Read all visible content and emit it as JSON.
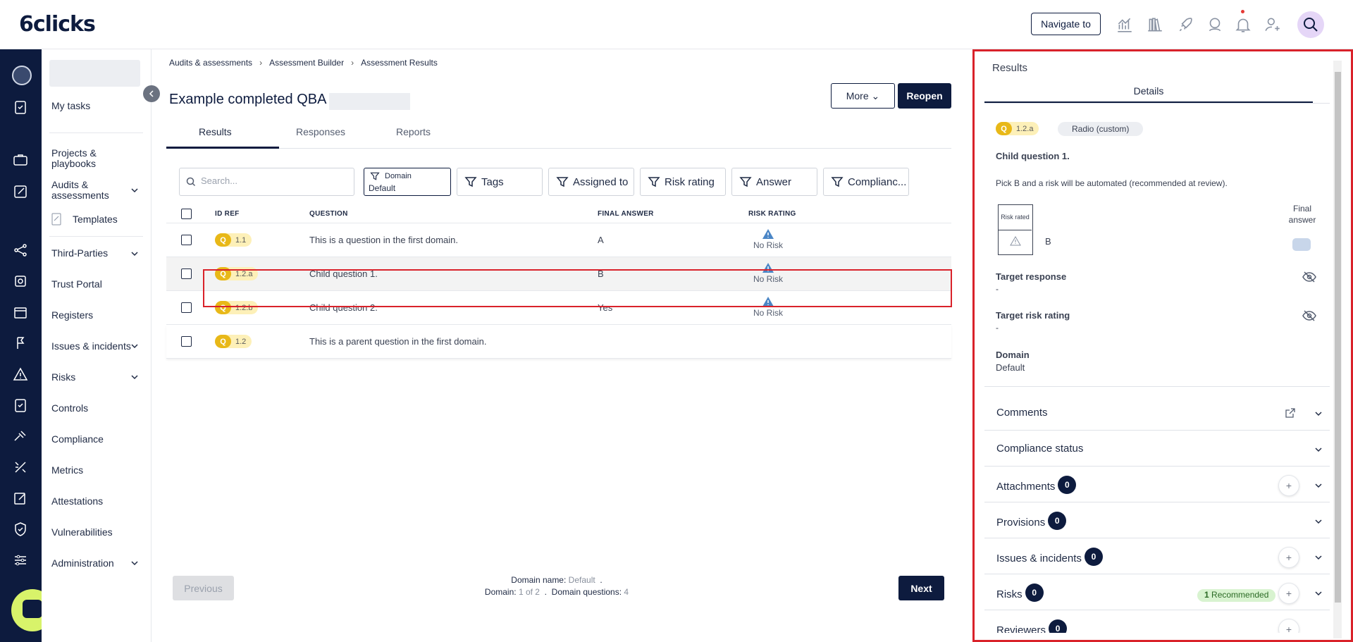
{
  "app": {
    "logo": "6clicks"
  },
  "topbar": {
    "navigate_label": "Navigate to"
  },
  "sidebar": {
    "items": [
      {
        "label": "My tasks"
      },
      {
        "label": "Projects & playbooks"
      },
      {
        "label": "Audits & assessments"
      },
      {
        "label": "Templates"
      },
      {
        "label": "Third-Parties"
      },
      {
        "label": "Trust Portal"
      },
      {
        "label": "Registers"
      },
      {
        "label": "Issues & incidents"
      },
      {
        "label": "Risks"
      },
      {
        "label": "Controls"
      },
      {
        "label": "Compliance"
      },
      {
        "label": "Metrics"
      },
      {
        "label": "Attestations"
      },
      {
        "label": "Vulnerabilities"
      },
      {
        "label": "Administration"
      }
    ]
  },
  "breadcrumb": [
    "Audits & assessments",
    "Assessment Builder",
    "Assessment Results"
  ],
  "page": {
    "title": "Example completed QBA",
    "more_label": "More",
    "reopen_label": "Reopen"
  },
  "tabs": [
    "Results",
    "Responses",
    "Reports"
  ],
  "filters": {
    "search_placeholder": "Search...",
    "domain_label": "Domain",
    "domain_value": "Default",
    "tags": "Tags",
    "assigned": "Assigned to",
    "risk": "Risk rating",
    "answer": "Answer",
    "compliance": "Complianc..."
  },
  "table": {
    "headers": {
      "id": "ID REF",
      "question": "QUESTION",
      "answer": "FINAL ANSWER",
      "risk": "RISK RATING"
    },
    "rows": [
      {
        "prefix": "Q",
        "id": "1.1",
        "question": "This is a question in the first domain.",
        "answer": "A",
        "risk": "No Risk"
      },
      {
        "prefix": "Q",
        "id": "1.2.a",
        "question": "Child question 1.",
        "answer": "B",
        "risk": "No Risk"
      },
      {
        "prefix": "Q",
        "id": "1.2.b",
        "question": "Child question 2.",
        "answer": "Yes",
        "risk": "No Risk"
      },
      {
        "prefix": "Q",
        "id": "1.2",
        "question": "This is a parent question in the first domain.",
        "answer": "",
        "risk": ""
      }
    ]
  },
  "footer": {
    "prev_label": "Previous",
    "next_label": "Next",
    "domain_name_label": "Domain name:",
    "domain_name_value": "Default",
    "domain_label": "Domain:",
    "domain_value": "1 of 2",
    "questions_label": "Domain questions:",
    "questions_value": "4"
  },
  "panel": {
    "title": "Results",
    "tab": "Details",
    "q_prefix": "Q",
    "q_id": "1.2.a",
    "type": "Radio (custom)",
    "question": "Child question 1.",
    "description": "Pick B and a risk will be automated (recommended at review).",
    "risk_rated": "Risk rated",
    "answer_option": "B",
    "final_answer": "Final answer",
    "target_response_label": "Target response",
    "target_response_value": "-",
    "target_risk_label": "Target risk rating",
    "target_risk_value": "-",
    "domain_label": "Domain",
    "domain_value": "Default",
    "sections": [
      {
        "label": "Comments"
      },
      {
        "label": "Compliance status"
      },
      {
        "label": "Attachments",
        "count": "0"
      },
      {
        "label": "Provisions",
        "count": "0"
      },
      {
        "label": "Issues & incidents",
        "count": "0"
      },
      {
        "label": "Risks",
        "count": "0",
        "recommended_count": "1",
        "recommended_label": "Recommended"
      },
      {
        "label": "Reviewers",
        "count": "0"
      }
    ]
  },
  "colors": {
    "brand": "#0d1b3e",
    "highlight": "#d9222a",
    "q_badge": "#e8b818"
  }
}
